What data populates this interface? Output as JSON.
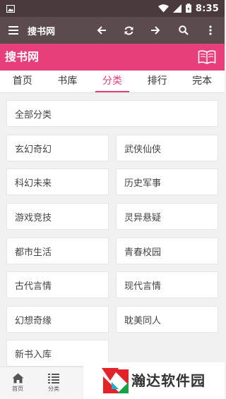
{
  "status_bar": {
    "time": "8:35"
  },
  "toolbar": {
    "title": "搜书网"
  },
  "brand": {
    "title": "搜书网"
  },
  "tabs": [
    {
      "label": "首页"
    },
    {
      "label": "书库"
    },
    {
      "label": "分类",
      "active": true
    },
    {
      "label": "排行"
    },
    {
      "label": "完本"
    }
  ],
  "categories": {
    "all": "全部分类",
    "items": [
      "玄幻奇幻",
      "武侠仙侠",
      "科幻未来",
      "历史军事",
      "游戏竞技",
      "灵异悬疑",
      "都市生活",
      "青春校园",
      "古代言情",
      "现代言情",
      "幻想奇缘",
      "耽美同人",
      "新书入库"
    ]
  },
  "bottom_nav": [
    {
      "label": "首页",
      "icon": "home-icon"
    },
    {
      "label": "分类",
      "icon": "list-icon"
    }
  ],
  "watermark": {
    "text": "瀚达软件园"
  },
  "colors": {
    "accent": "#e63f79",
    "toolbar": "#5b4b4e",
    "statusbar": "#4a3a3d"
  }
}
